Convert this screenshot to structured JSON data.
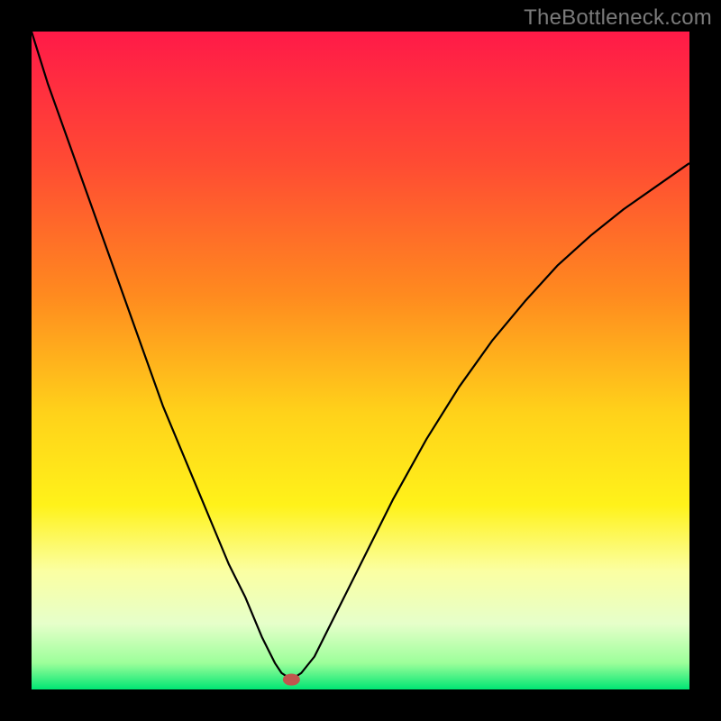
{
  "watermark": "TheBottleneck.com",
  "chart_data": {
    "type": "line",
    "title": "",
    "xlabel": "",
    "ylabel": "",
    "xlim": [
      0,
      100
    ],
    "ylim": [
      0,
      100
    ],
    "gradient_stops": [
      {
        "offset": 0.0,
        "color": "#ff1a48"
      },
      {
        "offset": 0.2,
        "color": "#ff4b33"
      },
      {
        "offset": 0.4,
        "color": "#ff8a1f"
      },
      {
        "offset": 0.58,
        "color": "#ffd21a"
      },
      {
        "offset": 0.72,
        "color": "#fff21a"
      },
      {
        "offset": 0.82,
        "color": "#fbffa2"
      },
      {
        "offset": 0.9,
        "color": "#e6ffca"
      },
      {
        "offset": 0.96,
        "color": "#9cff9a"
      },
      {
        "offset": 1.0,
        "color": "#00e573"
      }
    ],
    "series": [
      {
        "name": "curve",
        "x": [
          0,
          2.5,
          5,
          7.5,
          10,
          12.5,
          15,
          17.5,
          20,
          22.5,
          25,
          27.5,
          30,
          32.5,
          35,
          36,
          37,
          38,
          39.5,
          41,
          43,
          45,
          47.5,
          50,
          55,
          60,
          65,
          70,
          75,
          80,
          85,
          90,
          95,
          100
        ],
        "y": [
          100,
          92,
          85,
          78,
          71,
          64,
          57,
          50,
          43,
          37,
          31,
          25,
          19,
          14,
          8,
          6,
          4,
          2.5,
          1.5,
          2.5,
          5,
          9,
          14,
          19,
          29,
          38,
          46,
          53,
          59,
          64.5,
          69,
          73,
          76.5,
          80
        ]
      }
    ],
    "marker": {
      "x": 39.5,
      "y": 1.5,
      "rx": 1.3,
      "ry": 0.9,
      "color": "#c1564e"
    }
  }
}
